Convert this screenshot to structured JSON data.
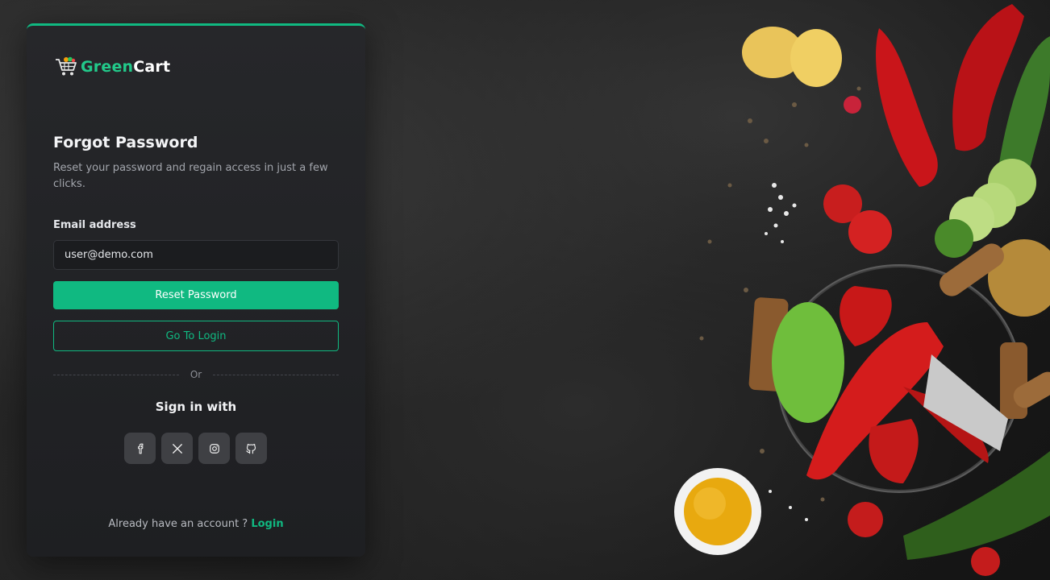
{
  "brand": {
    "name_part1": "Green",
    "name_part2": "Cart",
    "accent_color": "#10b981"
  },
  "form": {
    "title": "Forgot Password",
    "subtitle": "Reset your password and regain access in just a few clicks.",
    "email_label": "Email address",
    "email_value": "user@demo.com",
    "reset_button": "Reset Password",
    "login_button": "Go To Login"
  },
  "divider": {
    "label": "Or"
  },
  "social": {
    "title": "Sign in with",
    "icons": [
      "facebook-icon",
      "x-icon",
      "instagram-icon",
      "github-icon"
    ]
  },
  "footer": {
    "text": "Already have an account ?",
    "link": "Login"
  }
}
